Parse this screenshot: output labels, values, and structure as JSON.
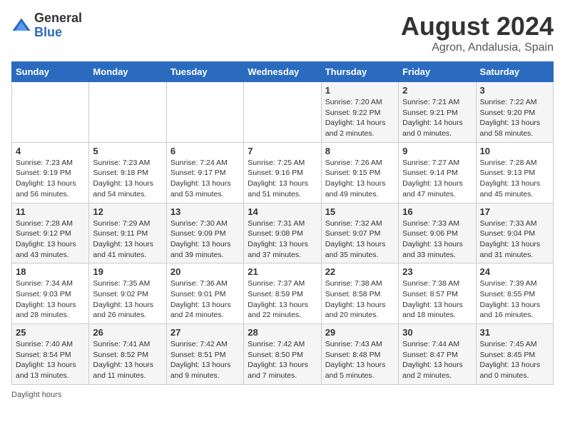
{
  "header": {
    "logo_general": "General",
    "logo_blue": "Blue",
    "month_title": "August 2024",
    "location": "Agron, Andalusia, Spain"
  },
  "weekdays": [
    "Sunday",
    "Monday",
    "Tuesday",
    "Wednesday",
    "Thursday",
    "Friday",
    "Saturday"
  ],
  "weeks": [
    [
      null,
      null,
      null,
      null,
      {
        "day": "1",
        "sunrise": "7:20 AM",
        "sunset": "9:22 PM",
        "daylight": "14 hours and 2 minutes."
      },
      {
        "day": "2",
        "sunrise": "7:21 AM",
        "sunset": "9:21 PM",
        "daylight": "14 hours and 0 minutes."
      },
      {
        "day": "3",
        "sunrise": "7:22 AM",
        "sunset": "9:20 PM",
        "daylight": "13 hours and 58 minutes."
      }
    ],
    [
      {
        "day": "4",
        "sunrise": "7:23 AM",
        "sunset": "9:19 PM",
        "daylight": "13 hours and 56 minutes."
      },
      {
        "day": "5",
        "sunrise": "7:23 AM",
        "sunset": "9:18 PM",
        "daylight": "13 hours and 54 minutes."
      },
      {
        "day": "6",
        "sunrise": "7:24 AM",
        "sunset": "9:17 PM",
        "daylight": "13 hours and 53 minutes."
      },
      {
        "day": "7",
        "sunrise": "7:25 AM",
        "sunset": "9:16 PM",
        "daylight": "13 hours and 51 minutes."
      },
      {
        "day": "8",
        "sunrise": "7:26 AM",
        "sunset": "9:15 PM",
        "daylight": "13 hours and 49 minutes."
      },
      {
        "day": "9",
        "sunrise": "7:27 AM",
        "sunset": "9:14 PM",
        "daylight": "13 hours and 47 minutes."
      },
      {
        "day": "10",
        "sunrise": "7:28 AM",
        "sunset": "9:13 PM",
        "daylight": "13 hours and 45 minutes."
      }
    ],
    [
      {
        "day": "11",
        "sunrise": "7:28 AM",
        "sunset": "9:12 PM",
        "daylight": "13 hours and 43 minutes."
      },
      {
        "day": "12",
        "sunrise": "7:29 AM",
        "sunset": "9:11 PM",
        "daylight": "13 hours and 41 minutes."
      },
      {
        "day": "13",
        "sunrise": "7:30 AM",
        "sunset": "9:09 PM",
        "daylight": "13 hours and 39 minutes."
      },
      {
        "day": "14",
        "sunrise": "7:31 AM",
        "sunset": "9:08 PM",
        "daylight": "13 hours and 37 minutes."
      },
      {
        "day": "15",
        "sunrise": "7:32 AM",
        "sunset": "9:07 PM",
        "daylight": "13 hours and 35 minutes."
      },
      {
        "day": "16",
        "sunrise": "7:33 AM",
        "sunset": "9:06 PM",
        "daylight": "13 hours and 33 minutes."
      },
      {
        "day": "17",
        "sunrise": "7:33 AM",
        "sunset": "9:04 PM",
        "daylight": "13 hours and 31 minutes."
      }
    ],
    [
      {
        "day": "18",
        "sunrise": "7:34 AM",
        "sunset": "9:03 PM",
        "daylight": "13 hours and 28 minutes."
      },
      {
        "day": "19",
        "sunrise": "7:35 AM",
        "sunset": "9:02 PM",
        "daylight": "13 hours and 26 minutes."
      },
      {
        "day": "20",
        "sunrise": "7:36 AM",
        "sunset": "9:01 PM",
        "daylight": "13 hours and 24 minutes."
      },
      {
        "day": "21",
        "sunrise": "7:37 AM",
        "sunset": "8:59 PM",
        "daylight": "13 hours and 22 minutes."
      },
      {
        "day": "22",
        "sunrise": "7:38 AM",
        "sunset": "8:58 PM",
        "daylight": "13 hours and 20 minutes."
      },
      {
        "day": "23",
        "sunrise": "7:38 AM",
        "sunset": "8:57 PM",
        "daylight": "13 hours and 18 minutes."
      },
      {
        "day": "24",
        "sunrise": "7:39 AM",
        "sunset": "8:55 PM",
        "daylight": "13 hours and 16 minutes."
      }
    ],
    [
      {
        "day": "25",
        "sunrise": "7:40 AM",
        "sunset": "8:54 PM",
        "daylight": "13 hours and 13 minutes."
      },
      {
        "day": "26",
        "sunrise": "7:41 AM",
        "sunset": "8:52 PM",
        "daylight": "13 hours and 11 minutes."
      },
      {
        "day": "27",
        "sunrise": "7:42 AM",
        "sunset": "8:51 PM",
        "daylight": "13 hours and 9 minutes."
      },
      {
        "day": "28",
        "sunrise": "7:42 AM",
        "sunset": "8:50 PM",
        "daylight": "13 hours and 7 minutes."
      },
      {
        "day": "29",
        "sunrise": "7:43 AM",
        "sunset": "8:48 PM",
        "daylight": "13 hours and 5 minutes."
      },
      {
        "day": "30",
        "sunrise": "7:44 AM",
        "sunset": "8:47 PM",
        "daylight": "13 hours and 2 minutes."
      },
      {
        "day": "31",
        "sunrise": "7:45 AM",
        "sunset": "8:45 PM",
        "daylight": "13 hours and 0 minutes."
      }
    ]
  ],
  "footer": {
    "daylight_label": "Daylight hours"
  }
}
